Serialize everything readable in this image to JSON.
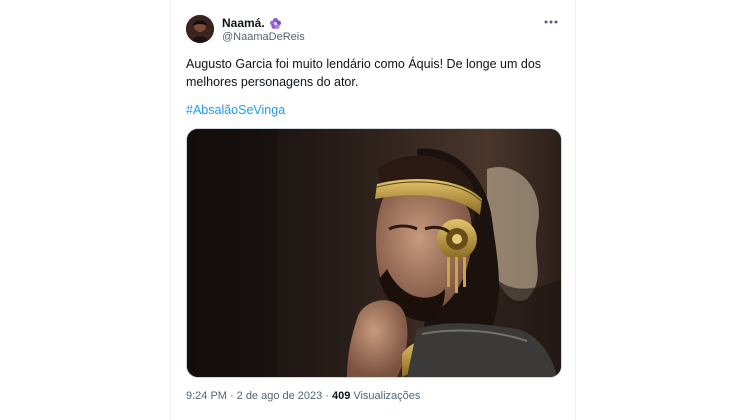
{
  "tweet": {
    "display_name": "Naamá.",
    "badge_emoji": "purple-flower-emoji",
    "handle": "@NaamaDeReis",
    "text": "Augusto Garcia foi muito lendário como Áquis! De longe um dos melhores personagens do ator.",
    "hashtag": "#AbsalãoSeVinga",
    "time": "9:24 PM",
    "separator": "·",
    "date": "2 de ago de 2023",
    "views_count": "409",
    "views_label": "Visualizações"
  },
  "icons": {
    "more": "more-horizontal-icon"
  },
  "colors": {
    "link": "#1d9bf0",
    "secondary_text": "#536471",
    "primary_text": "#0f1419",
    "badge": "#8b5cc4"
  }
}
